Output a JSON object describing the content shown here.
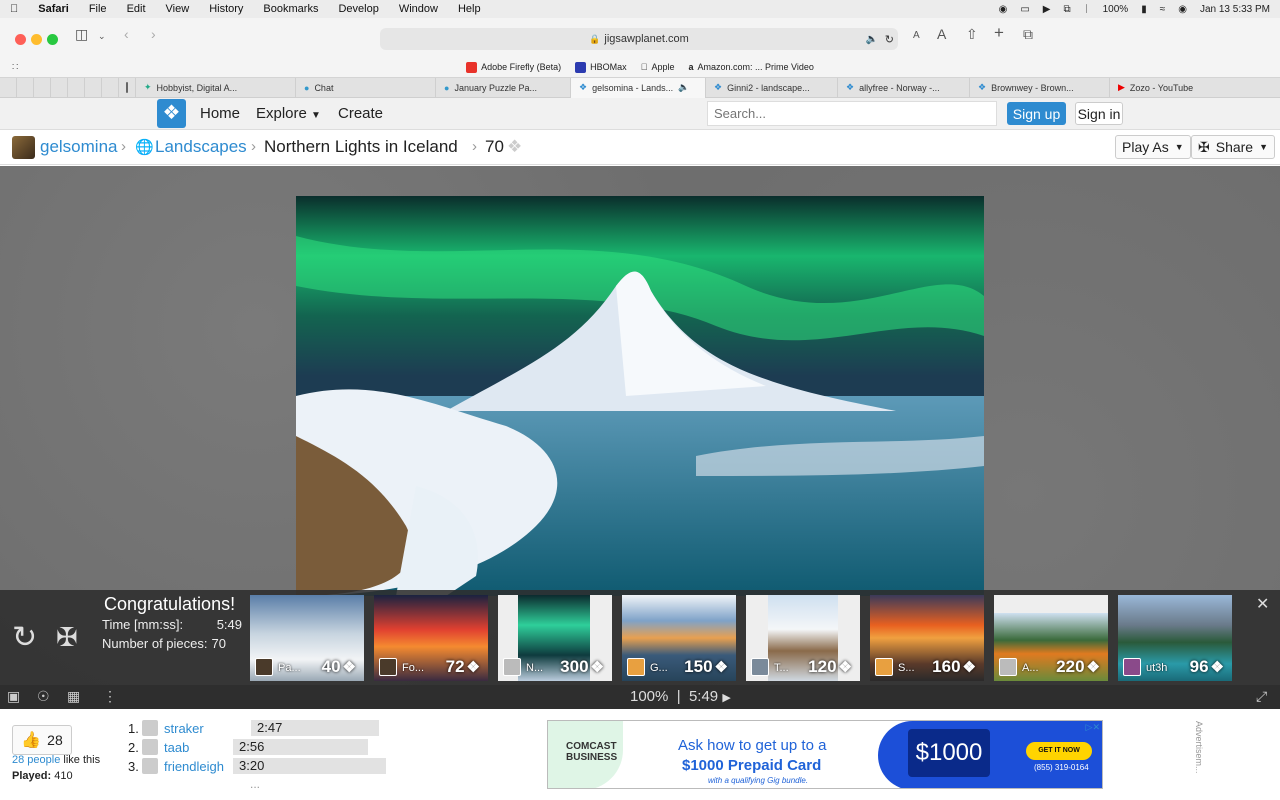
{
  "menubar": {
    "app": "Safari",
    "items": [
      "File",
      "Edit",
      "View",
      "History",
      "Bookmarks",
      "Develop",
      "Window",
      "Help"
    ],
    "battery": "100%",
    "datetime": "Jan 13  5:33 PM"
  },
  "browser": {
    "url": "jigsawplanet.com",
    "favorites": [
      "Adobe Firefly (Beta)",
      "HBOMax",
      "Apple",
      "Amazon.com: ... Prime Video"
    ],
    "tabs": [
      "Hobbyist, Digital A...",
      "Chat",
      "January Puzzle Pa...",
      "gelsomina - Lands...",
      "Ginni2 - landscape...",
      "allyfree - Norway -...",
      "Brownwey - Brown...",
      "Zozo - YouTube"
    ],
    "active_tab_index": 3
  },
  "site": {
    "nav": {
      "home": "Home",
      "explore": "Explore",
      "create": "Create"
    },
    "search_placeholder": "Search...",
    "signup": "Sign up",
    "signin": "Sign in"
  },
  "breadcrumb": {
    "user": "gelsomina",
    "category": "Landscapes",
    "title": "Northern Lights in Iceland",
    "pieces": "70",
    "play_as": "Play As",
    "share": "Share"
  },
  "congrats": {
    "title": "Congratulations!",
    "time_label": "Time [mm:ss]:",
    "time_value": "5:49",
    "pieces_label": "Number of pieces:",
    "pieces_value": "70"
  },
  "suggestions": [
    {
      "name": "Pa...",
      "count": "40"
    },
    {
      "name": "Fo...",
      "count": "72"
    },
    {
      "name": "N...",
      "count": "300"
    },
    {
      "name": "G...",
      "count": "150"
    },
    {
      "name": "T...",
      "count": "120"
    },
    {
      "name": "S...",
      "count": "160"
    },
    {
      "name": "A...",
      "count": "220"
    },
    {
      "name": "ut3h",
      "count": "96"
    }
  ],
  "status": {
    "zoom": "100%",
    "timer": "5:49"
  },
  "footer": {
    "like_count": "28",
    "likes_link": "28 people",
    "likes_text": " like this",
    "played_label": "Played:",
    "played_value": "410",
    "scores": [
      {
        "rank": "1.",
        "name": "straker",
        "time": "2:47"
      },
      {
        "rank": "2.",
        "name": "taab",
        "time": "2:56"
      },
      {
        "rank": "3.",
        "name": "friendleigh",
        "time": "3:20"
      }
    ],
    "more": "...",
    "ad": {
      "brand": "COMCAST BUSINESS",
      "line1": "Ask how to get up to a",
      "line2": "$1000 Prepaid Card",
      "small": "with a qualifying Gig bundle.",
      "card": "$1000",
      "cta": "GET IT NOW",
      "phone": "(855) 319-0164",
      "label": "Advertisem..."
    }
  },
  "colors": {
    "accent": "#2e8bd0",
    "ad_blue": "#1c4fd8"
  }
}
